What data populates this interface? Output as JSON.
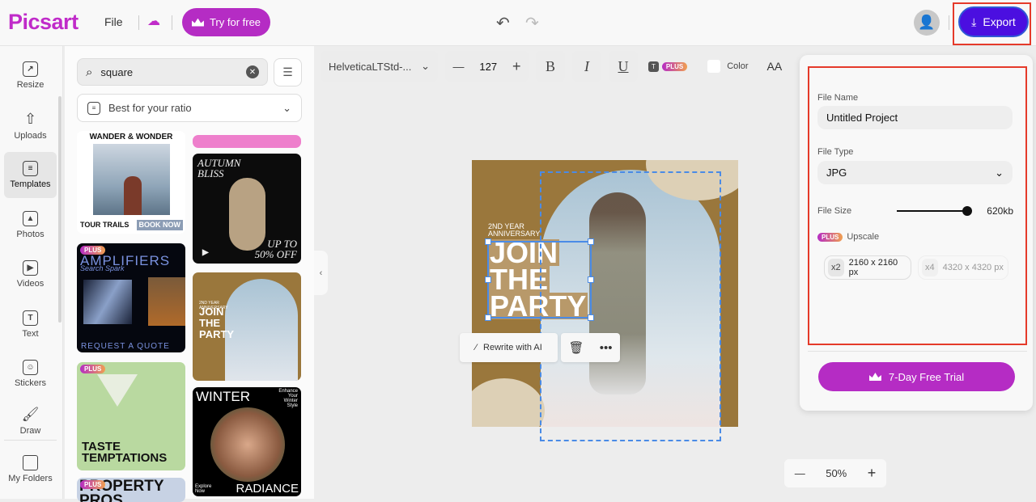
{
  "app": {
    "logo": "Picsart",
    "file_menu": "File",
    "try_free": "Try for free",
    "export": "Export"
  },
  "rail": [
    {
      "label": "Resize",
      "icon": "resize-icon"
    },
    {
      "label": "Uploads",
      "icon": "upload-icon"
    },
    {
      "label": "Templates",
      "icon": "templates-icon"
    },
    {
      "label": "Photos",
      "icon": "photos-icon"
    },
    {
      "label": "Videos",
      "icon": "videos-icon"
    },
    {
      "label": "Text",
      "icon": "text-icon"
    },
    {
      "label": "Stickers",
      "icon": "stickers-icon"
    },
    {
      "label": "Draw",
      "icon": "brush-icon"
    },
    {
      "label": "My Folders",
      "icon": "folder-icon"
    }
  ],
  "panel": {
    "search_value": "square",
    "ratio_filter": "Best for your ratio",
    "templates": [
      {
        "title": "WANDER & WONDER",
        "sub": "TOUR TRAILS",
        "cta": "BOOK NOW"
      },
      {
        "title": "AUTUMN BLISS",
        "sub": "UP TO 50% OFF"
      },
      {
        "title": "AMPLIFIERS",
        "sub": "Search Spark",
        "cta": "REQUEST A QUOTE",
        "badge": "PLUS"
      },
      {
        "title": "JOIN THE PARTY",
        "sub": "2ND YEAR ANNIVERSARY"
      },
      {
        "title": "TASTE TEMPTATIONS",
        "badge": "PLUS"
      },
      {
        "title": "WINTER",
        "sub": "RADIANCE",
        "cta": "Explore Now",
        "extra": "Enhance Your Winter Style"
      },
      {
        "title": "PROPERTY PROS",
        "badge": "PLUS"
      }
    ]
  },
  "toolbar": {
    "font": "HelveticaLTStd-...",
    "font_size": "127",
    "bold": "B",
    "italic": "I",
    "underline": "U",
    "plus_badge": "PLUS",
    "color_label": "Color",
    "case": "AA"
  },
  "canvas": {
    "subtitle_line1": "2ND YEAR",
    "subtitle_line2": "ANNIVERSARY",
    "headline": [
      "JOIN",
      "THE",
      "PARTY"
    ],
    "rewrite": "Rewrite with AI",
    "zoom": "50%"
  },
  "export_panel": {
    "file_name_label": "File Name",
    "file_name": "Untitled Project",
    "file_type_label": "File Type",
    "file_type": "JPG",
    "file_size_label": "File Size",
    "file_size": "620kb",
    "file_size_slider": 1.0,
    "plus_badge": "PLUS",
    "upscale_label": "Upscale",
    "options": [
      {
        "mult": "x2",
        "size": "2160 x 2160 px",
        "selected": true
      },
      {
        "mult": "x4",
        "size": "4320 x 4320 px",
        "selected": false
      }
    ],
    "trial": "7-Day Free Trial"
  },
  "colors": {
    "brand": "#b52cc4",
    "export": "#4b0fe0",
    "highlight": "#e53a2a",
    "selection": "#4a8be6"
  }
}
